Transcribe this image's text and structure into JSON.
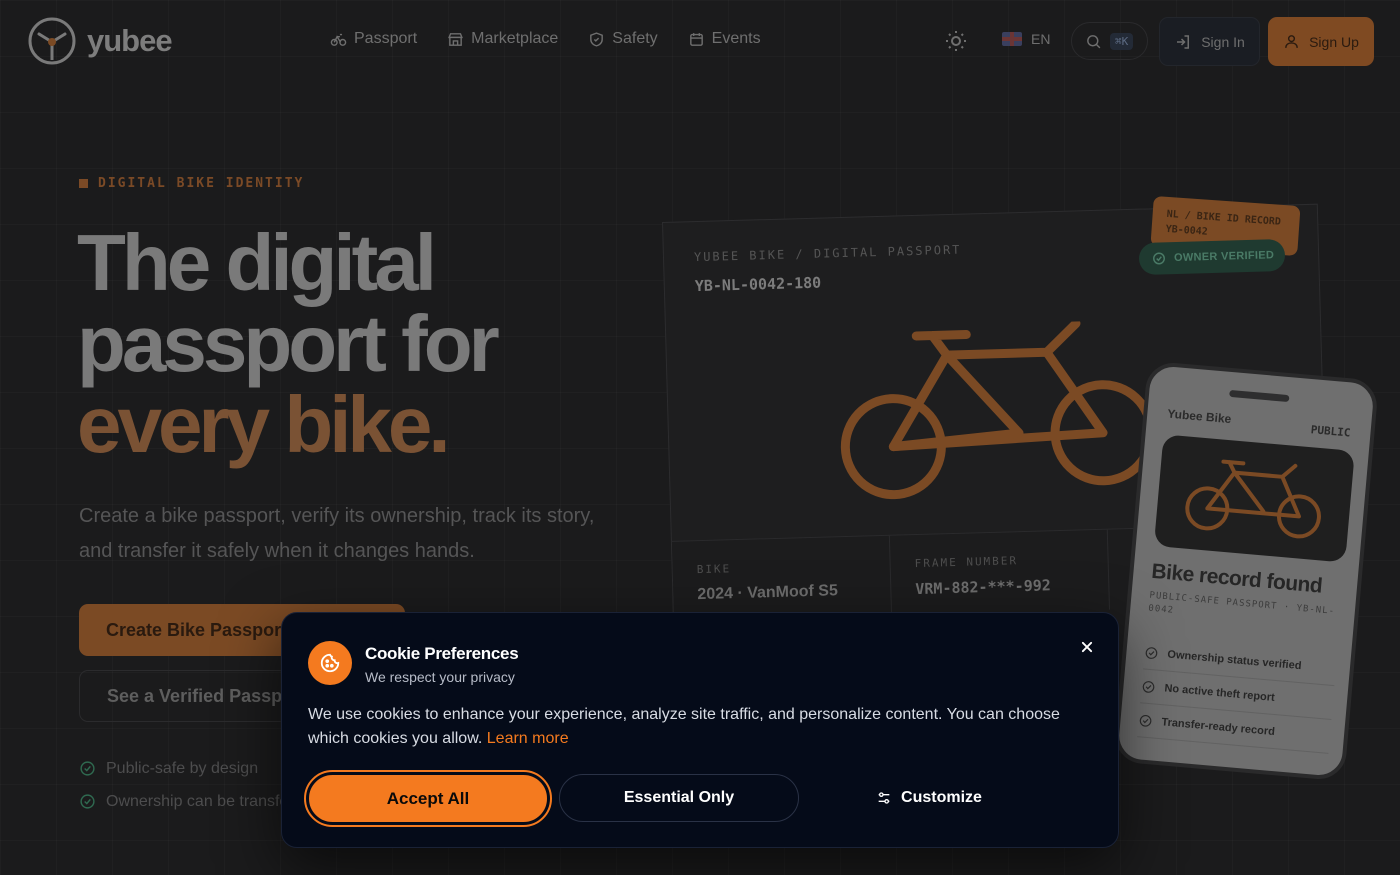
{
  "brand": {
    "name": "yubee"
  },
  "nav": {
    "items": [
      {
        "label": "Passport",
        "icon": "bike-icon"
      },
      {
        "label": "Marketplace",
        "icon": "store-icon"
      },
      {
        "label": "Safety",
        "icon": "shield-icon"
      },
      {
        "label": "Events",
        "icon": "calendar-icon"
      }
    ],
    "language": "EN",
    "search_shortcut": "⌘K",
    "signin_label": "Sign In",
    "signup_label": "Sign Up"
  },
  "hero": {
    "eyebrow": "DIGITAL BIKE IDENTITY",
    "headline_line1": "The digital",
    "headline_line2": "passport for",
    "headline_accent": "every bike.",
    "subtext": "Create a bike passport, verify its ownership, track its story, and transfer it safely when it changes hands.",
    "primary_cta": "Create Bike Passport",
    "secondary_cta": "See a Verified Passport",
    "checks": [
      "Public-safe by design",
      "Ownership can be transferred"
    ]
  },
  "passport_card": {
    "label": "YUBEE BIKE / DIGITAL PASSPORT",
    "id": "YB-NL-0042-180",
    "owner_badge": "OWNER VERIFIED",
    "tag_line1": "NL / BIKE ID RECORD",
    "tag_line2": "YB-0042",
    "bike_label": "BIKE",
    "bike_value": "2024 · VanMoof S5",
    "frame_label": "FRAME NUMBER",
    "frame_value": "VRM-882-***-992"
  },
  "phone": {
    "brand": "Yubee Bike",
    "visibility": "PUBLIC",
    "title": "Bike record found",
    "subtitle": "PUBLIC-SAFE PASSPORT · YB-NL-0042",
    "items": [
      "Ownership status verified",
      "No active theft report",
      "Transfer-ready record"
    ]
  },
  "cookie_modal": {
    "title": "Cookie Preferences",
    "subtitle": "We respect your privacy",
    "body": "We use cookies to enhance your experience, analyze site traffic, and personalize content. You can choose which cookies you allow.",
    "learn_more": "Learn more",
    "accept_label": "Accept All",
    "essential_label": "Essential Only",
    "customize_label": "Customize"
  },
  "colors": {
    "accent": "#f47a1f",
    "modal_bg": "#050b19",
    "page_bg": "#1b1b1c"
  }
}
